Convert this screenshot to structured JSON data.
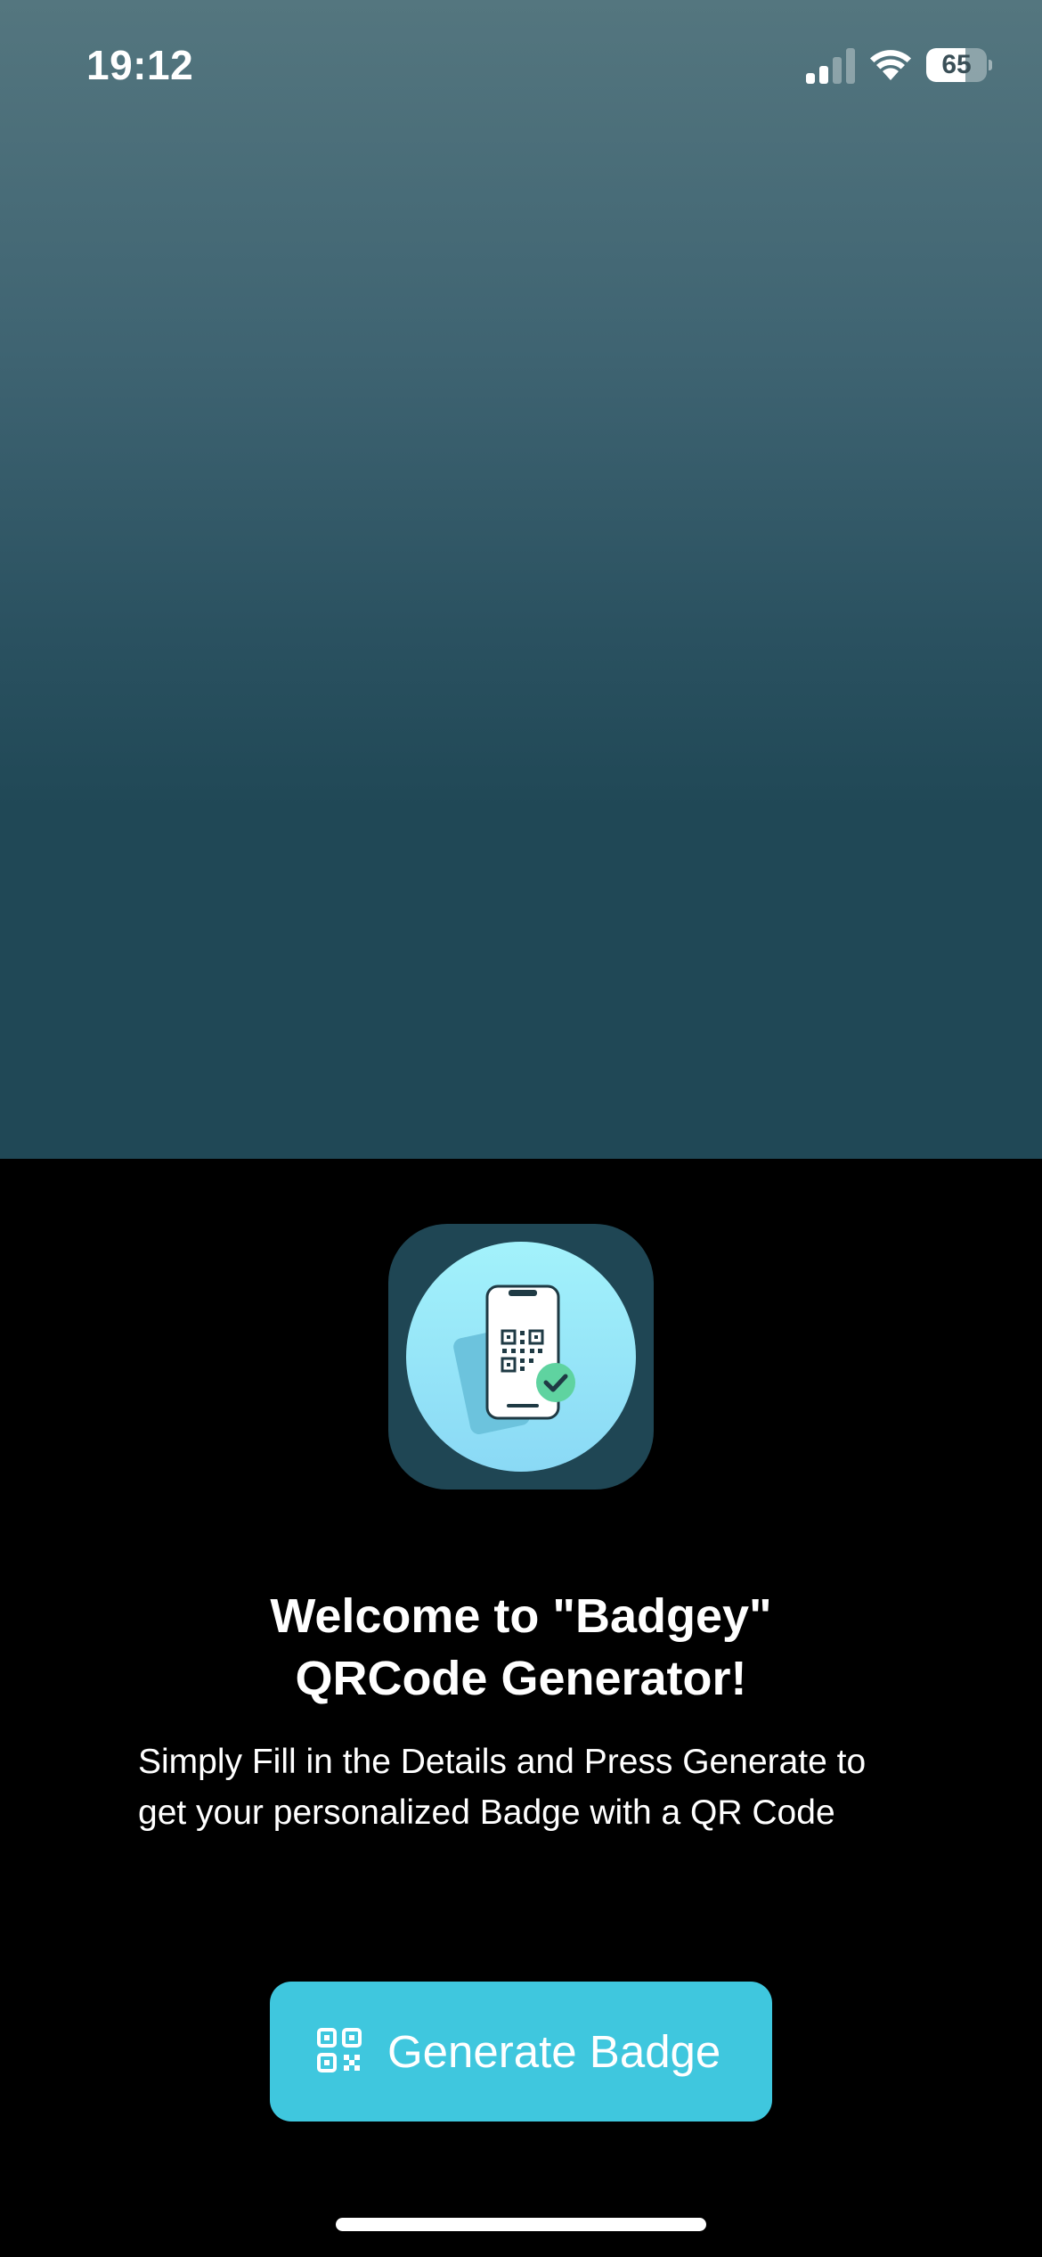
{
  "status_bar": {
    "time": "19:12",
    "battery_level": "65",
    "battery_fraction": 0.65,
    "icons": [
      "cellular-signal-icon",
      "wifi-icon",
      "battery-icon"
    ]
  },
  "app_icon": {
    "icon": "phone-qr-check-icon"
  },
  "welcome": {
    "title_line1": "Welcome to \"Badgey\"",
    "title_line2": "QRCode Generator!",
    "body": "Simply Fill in the Details and Press Generate to get your personalized Badge with a QR Code"
  },
  "generate_button": {
    "label": "Generate Badge",
    "icon": "qr-code-icon"
  },
  "colors": {
    "hero_top": "#54767f",
    "hero_bottom": "#204856",
    "accent": "#3fc7de",
    "icon_bg": "#1f4654",
    "check_green": "#5fd3a0"
  }
}
